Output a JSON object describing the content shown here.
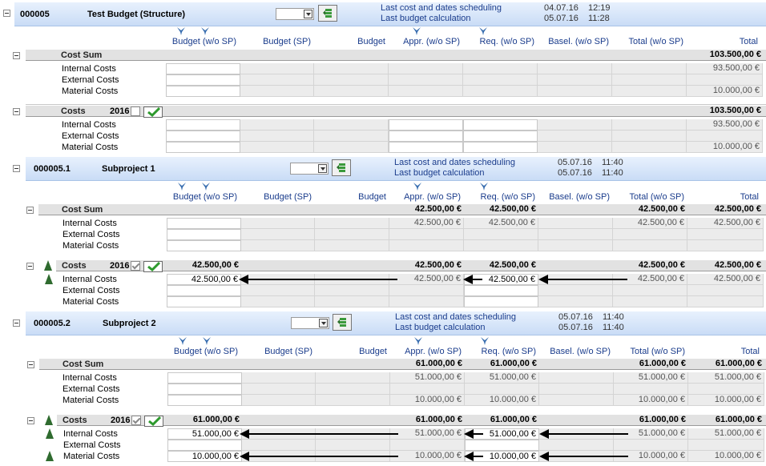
{
  "columns": [
    "Budget (w/o SP)",
    "Budget (SP)",
    "Budget",
    "Appr. (w/o SP)",
    "Req. (w/o SP)",
    "Basel. (w/o SP)",
    "Total (w/o SP)",
    "Total"
  ],
  "row_labels": {
    "cost_sum": "Cost Sum",
    "costs": "Costs",
    "internal": "Internal Costs",
    "external": "External Costs",
    "material": "Material Costs"
  },
  "project": {
    "id": "000005",
    "title": "Test Budget (Structure)",
    "sched_label": "Last cost and dates scheduling",
    "calc_label": "Last budget calculation",
    "sched_date": "04.07.16",
    "sched_time": "12:19",
    "calc_date": "05.07.16",
    "calc_time": "11:28",
    "cost_sum": {
      "total": "103.500,00 €",
      "internal": "93.500,00 €",
      "material": "10.000,00 €"
    },
    "costs": {
      "year": "2016",
      "total": "103.500,00 €",
      "internal": "93.500,00 €",
      "material": "10.000,00 €"
    }
  },
  "sub1": {
    "id": "000005.1",
    "title": "Subproject 1",
    "sched_label": "Last cost and dates scheduling",
    "calc_label": "Last budget calculation",
    "sched_date": "05.07.16",
    "sched_time": "11:40",
    "calc_date": "05.07.16",
    "calc_time": "11:40",
    "cost_sum": {
      "v": "42.500,00 €"
    },
    "costs": {
      "year": "2016",
      "v": "42.500,00 €"
    }
  },
  "sub2": {
    "id": "000005.2",
    "title": "Subproject 2",
    "sched_label": "Last cost and dates scheduling",
    "calc_label": "Last budget calculation",
    "sched_date": "05.07.16",
    "sched_time": "11:40",
    "calc_date": "05.07.16",
    "calc_time": "11:40",
    "cost_sum": {
      "total": "61.000,00 €",
      "internal": "51.000,00 €",
      "material": "10.000,00 €"
    },
    "costs": {
      "year": "2016",
      "total": "61.000,00 €",
      "internal": "51.000,00 €",
      "material": "10.000,00 €"
    }
  },
  "colors": {
    "link": "#1a3c8c",
    "band": "#c9dcf6",
    "tree": "#2f6b2f"
  },
  "icons": [
    "collapse-icon",
    "dropdown-icon",
    "calculate-icon",
    "filter-funnel-icon",
    "checkbox-icon",
    "confirm-check-icon",
    "tree-icon",
    "arrow-left-icon"
  ]
}
